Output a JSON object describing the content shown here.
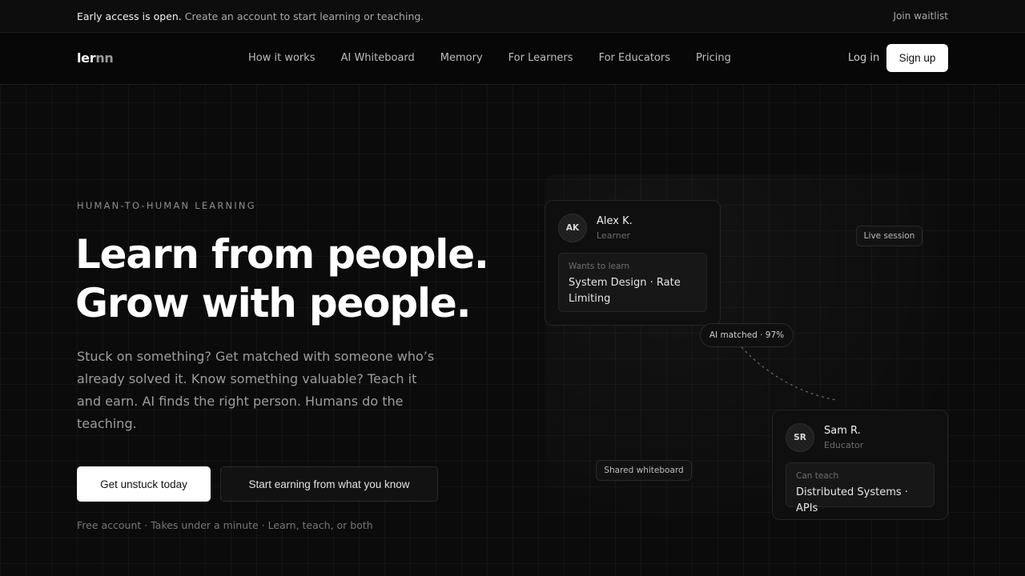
{
  "announcement": {
    "strong": "Early access is open.",
    "text": "Create an account to start learning or teaching.",
    "link": "Join waitlist"
  },
  "nav": {
    "logo_main": "ler",
    "logo_dim": "nn",
    "links": [
      "How it works",
      "AI Whiteboard",
      "Memory",
      "For Learners",
      "For Educators",
      "Pricing"
    ],
    "login": "Log in",
    "signup": "Sign up"
  },
  "hero": {
    "eyebrow": "HUMAN-TO-HUMAN LEARNING",
    "headline_line1": "Learn from people.",
    "headline_line2": "Grow with people.",
    "subtext": "Stuck on something? Get matched with someone who’s already solved it. Know something valuable? Teach it and earn. AI finds the right person. Humans do the teaching.",
    "primary_cta": "Get unstuck today",
    "secondary_cta": "Start earning from what you know",
    "footnote": "Free account · Takes under a minute · Learn, teach, or both"
  },
  "illustration": {
    "learner": {
      "initials": "AK",
      "name": "Alex K.",
      "role": "Learner",
      "box_label": "Wants to learn",
      "box_value": "System Design · Rate Limiting"
    },
    "educator": {
      "initials": "SR",
      "name": "Sam R.",
      "role": "Educator",
      "box_label": "Can teach",
      "box_value": "Distributed Systems · APIs"
    },
    "live_session": "Live session",
    "ai_matched": "AI matched · 97%",
    "shared_whiteboard": "Shared whiteboard"
  },
  "colors": {
    "background": "#0b0b0b",
    "primary_button": "#ffffff",
    "text_primary": "#ffffff",
    "text_muted": "#9d9d9d"
  }
}
